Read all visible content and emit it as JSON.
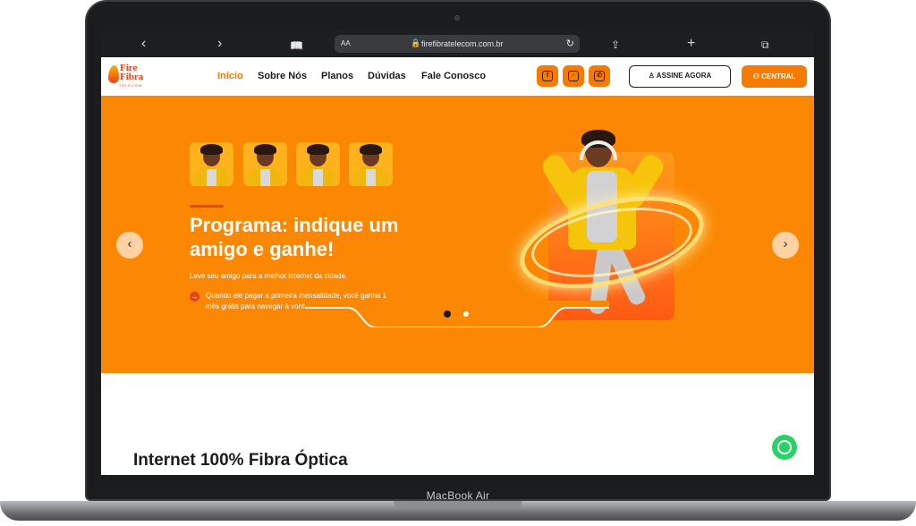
{
  "device": {
    "label": "MacBook Air"
  },
  "browser": {
    "url": "firefibratelecom.com.br",
    "text_size_label": "AA",
    "back_icon": "‹",
    "forward_icon": "›",
    "reader_icon": "book-icon",
    "reload_icon": "↻",
    "share_icon": "share-icon",
    "new_tab_icon": "+",
    "tabs_icon": "tabs-icon"
  },
  "site": {
    "logo": {
      "line1": "Fire",
      "line2": "Fibra",
      "line3": "TELECOM"
    },
    "nav": [
      "Início",
      "Sobre Nós",
      "Planos",
      "Dúvidas",
      "Fale Conosco"
    ],
    "social": [
      "facebook",
      "instagram",
      "whatsapp"
    ],
    "cta_outline": "ASSINE AGORA",
    "cta_solid": "CENTRAL",
    "colors": {
      "accent": "#f57c00",
      "hero_bg": "#fb8703",
      "red": "#e8431b"
    }
  },
  "hero": {
    "title": "Programa: indique um amigo e ganhe!",
    "subtitle": "Leve seu amigo para a melhor internet da cidade.",
    "point": "Quando ele pagar a primeira mensalidade, você ganha 1 mês grátis para navegar à vontade.",
    "prev_icon": "‹",
    "next_icon": "›",
    "slides": 2,
    "active_slide": 1
  },
  "section": {
    "title": "Internet 100% Fibra Óptica"
  }
}
